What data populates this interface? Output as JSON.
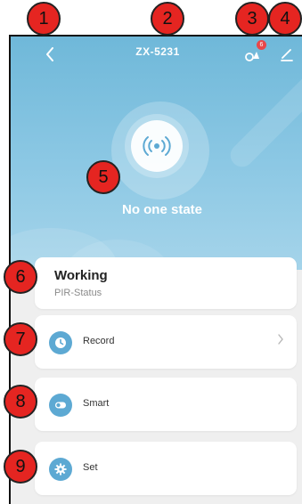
{
  "header": {
    "title": "ZX-5231",
    "share_badge_count": "6"
  },
  "status": {
    "state_text": "No one state"
  },
  "working_card": {
    "title": "Working",
    "subtitle": "PIR-Status"
  },
  "menu": {
    "record_label": "Record",
    "smart_label": "Smart",
    "set_label": "Set"
  },
  "annotations": [
    "1",
    "2",
    "3",
    "4",
    "5",
    "6",
    "7",
    "8",
    "9"
  ],
  "colors": {
    "hero": "#7bbfdf",
    "accent": "#5da9d3",
    "badge": "#e52521"
  }
}
